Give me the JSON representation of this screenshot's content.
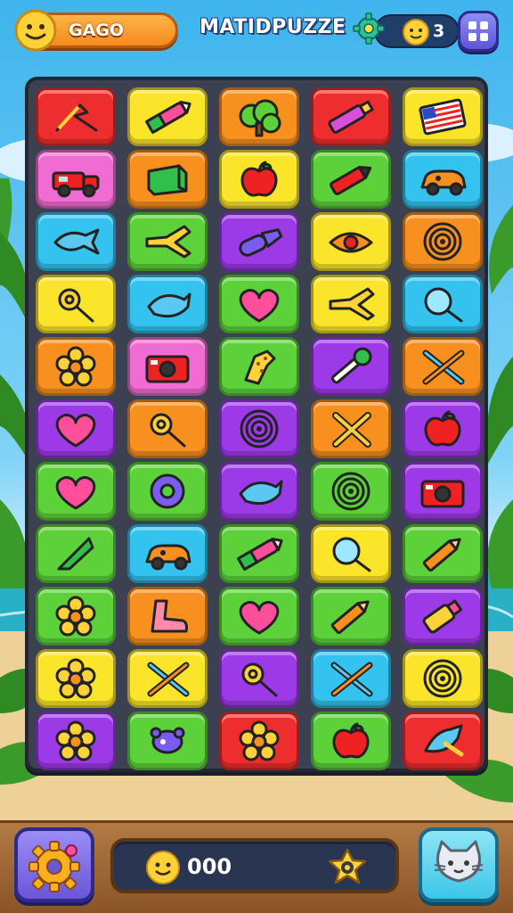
{
  "header": {
    "player_name": "GAGO",
    "title": "MATIDPUZZE",
    "coins": "3"
  },
  "score": {
    "value": "000"
  },
  "colors": {
    "red": "#ee2e2e",
    "yellow": "#fbe52a",
    "orange": "#f7901e",
    "green": "#5cd13a",
    "cyan": "#33c3ee",
    "purple": "#9b3ae6",
    "pink": "#f06cd2"
  },
  "board": {
    "rows": [
      [
        {
          "color": "red",
          "icon": "boomerang-icon"
        },
        {
          "color": "yellow",
          "icon": "crayon-icon"
        },
        {
          "color": "orange",
          "icon": "tree-icon"
        },
        {
          "color": "red",
          "icon": "marker-icon"
        },
        {
          "color": "yellow",
          "icon": "flag-book-icon"
        }
      ],
      [
        {
          "color": "pink",
          "icon": "truck-icon"
        },
        {
          "color": "orange",
          "icon": "green-box-icon"
        },
        {
          "color": "yellow",
          "icon": "apple-icon"
        },
        {
          "color": "green",
          "icon": "pen-icon"
        },
        {
          "color": "cyan",
          "icon": "car-icon"
        }
      ],
      [
        {
          "color": "cyan",
          "icon": "fish-icon"
        },
        {
          "color": "green",
          "icon": "plane-icon"
        },
        {
          "color": "purple",
          "icon": "brush-icon"
        },
        {
          "color": "yellow",
          "icon": "eye-icon"
        },
        {
          "color": "orange",
          "icon": "spiral-icon"
        }
      ],
      [
        {
          "color": "yellow",
          "icon": "lollipop-icon"
        },
        {
          "color": "cyan",
          "icon": "bird-icon"
        },
        {
          "color": "green",
          "icon": "heart-icon"
        },
        {
          "color": "yellow",
          "icon": "plane-icon"
        },
        {
          "color": "cyan",
          "icon": "magnifier-icon"
        }
      ],
      [
        {
          "color": "orange",
          "icon": "flower-icon"
        },
        {
          "color": "pink",
          "icon": "camera-icon"
        },
        {
          "color": "green",
          "icon": "giraffe-icon"
        },
        {
          "color": "purple",
          "icon": "paintbrush-icon"
        },
        {
          "color": "orange",
          "icon": "cross-tools-icon"
        }
      ],
      [
        {
          "color": "purple",
          "icon": "heart-icon"
        },
        {
          "color": "orange",
          "icon": "lollipop-icon"
        },
        {
          "color": "purple",
          "icon": "spiral-icon"
        },
        {
          "color": "orange",
          "icon": "cross-icon"
        },
        {
          "color": "purple",
          "icon": "apple-icon"
        }
      ],
      [
        {
          "color": "green",
          "icon": "heart-icon"
        },
        {
          "color": "green",
          "icon": "donut-icon"
        },
        {
          "color": "purple",
          "icon": "bird-icon"
        },
        {
          "color": "green",
          "icon": "spiral-icon"
        },
        {
          "color": "purple",
          "icon": "camera-icon"
        }
      ],
      [
        {
          "color": "green",
          "icon": "triangle-icon"
        },
        {
          "color": "cyan",
          "icon": "car-icon"
        },
        {
          "color": "green",
          "icon": "crayon-icon"
        },
        {
          "color": "yellow",
          "icon": "magnifier-icon"
        },
        {
          "color": "green",
          "icon": "pencil-icon"
        }
      ],
      [
        {
          "color": "green",
          "icon": "flower-icon"
        },
        {
          "color": "orange",
          "icon": "boot-icon"
        },
        {
          "color": "green",
          "icon": "heart-icon"
        },
        {
          "color": "green",
          "icon": "pencil-icon"
        },
        {
          "color": "purple",
          "icon": "glue-icon"
        }
      ],
      [
        {
          "color": "yellow",
          "icon": "flower-icon"
        },
        {
          "color": "yellow",
          "icon": "cross-tools-icon"
        },
        {
          "color": "purple",
          "icon": "lollipop-icon"
        },
        {
          "color": "cyan",
          "icon": "cross-tools-icon"
        },
        {
          "color": "yellow",
          "icon": "spiral-icon"
        }
      ],
      [
        {
          "color": "purple",
          "icon": "flower-icon"
        },
        {
          "color": "green",
          "icon": "bug-icon"
        },
        {
          "color": "red",
          "icon": "flower-icon"
        },
        {
          "color": "green",
          "icon": "apple-icon"
        },
        {
          "color": "red",
          "icon": "leaf-bird-icon"
        }
      ]
    ]
  },
  "icons": {
    "top_gear": "gear-icon",
    "coin": "coin-face-icon",
    "menu": "grid-menu-icon",
    "settings": "settings-gear-icon",
    "score_face": "smiley-face-icon",
    "star_badge": "star-badge-icon",
    "cat": "cat-face-icon"
  }
}
